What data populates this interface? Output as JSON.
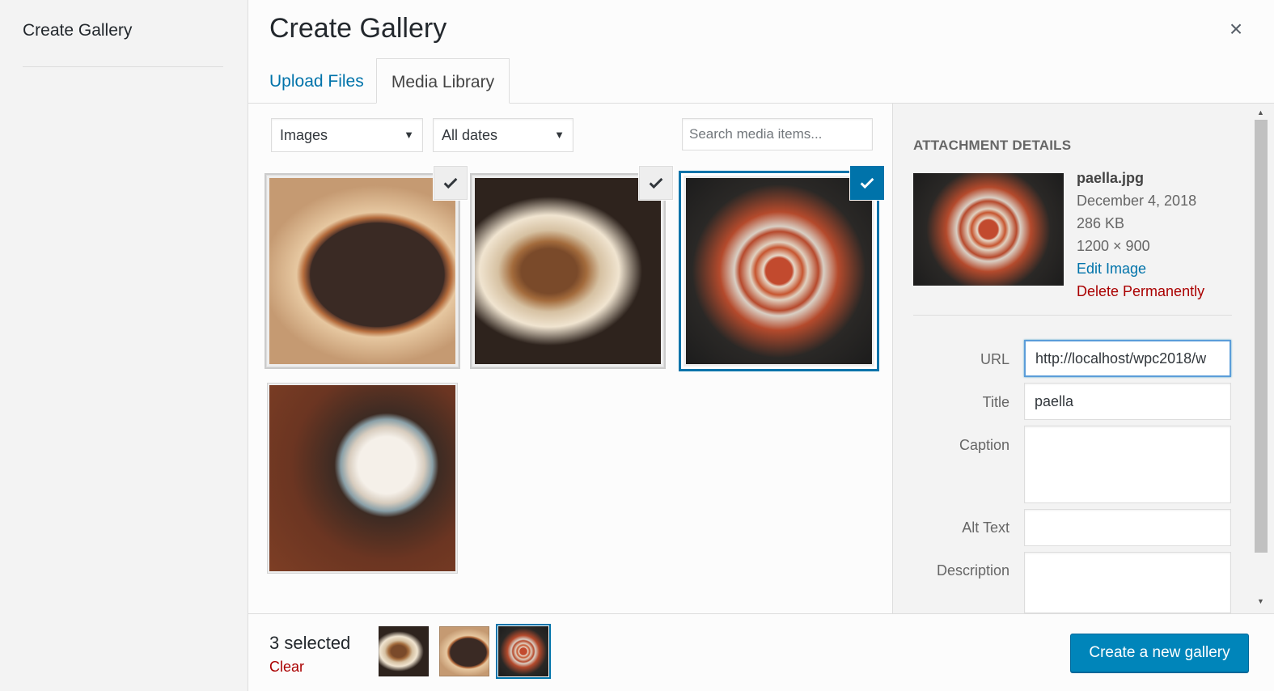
{
  "sidebar": {
    "title": "Create Gallery"
  },
  "header": {
    "title": "Create Gallery",
    "close_icon": "×"
  },
  "tabs": [
    {
      "label": "Upload Files",
      "active": false
    },
    {
      "label": "Media Library",
      "active": true
    }
  ],
  "toolbar": {
    "type_filter": "Images",
    "date_filter": "All dates",
    "search_placeholder": "Search media items..."
  },
  "attachments": [
    {
      "subject": "mussels",
      "selected": true,
      "details": false
    },
    {
      "subject": "meat",
      "selected": true,
      "details": false
    },
    {
      "subject": "paella",
      "selected": true,
      "details": true
    },
    {
      "subject": "bowl",
      "selected": false,
      "details": false
    }
  ],
  "details": {
    "heading": "ATTACHMENT DETAILS",
    "filename": "paella.jpg",
    "date": "December 4, 2018",
    "size": "286 KB",
    "dimensions": "1200 × 900",
    "edit_link": "Edit Image",
    "delete_link": "Delete Permanently",
    "fields": {
      "url_label": "URL",
      "url_value": "http://localhost/wpc2018/w",
      "title_label": "Title",
      "title_value": "paella",
      "caption_label": "Caption",
      "caption_value": "",
      "alt_label": "Alt Text",
      "alt_value": "",
      "description_label": "Description",
      "description_value": ""
    }
  },
  "footer": {
    "selected_text": "3 selected",
    "clear_link": "Clear",
    "create_button": "Create a new gallery"
  },
  "colors": {
    "accent": "#0073aa",
    "button": "#0085ba",
    "delete": "#a00"
  }
}
